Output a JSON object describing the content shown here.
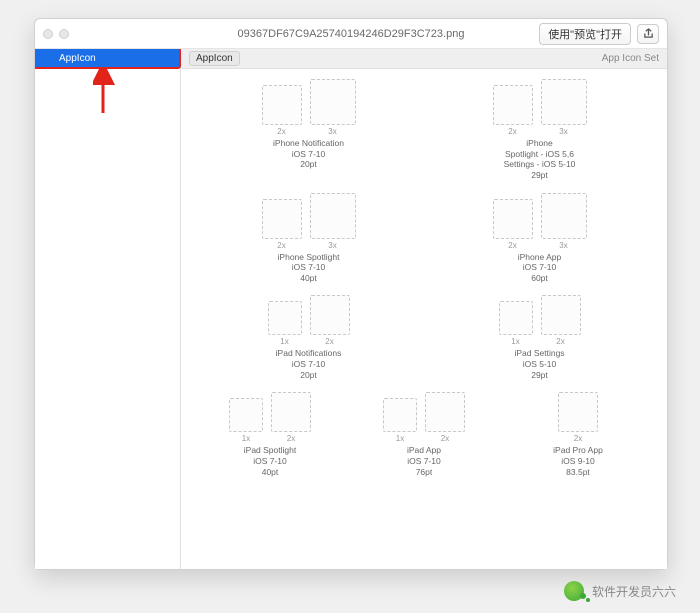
{
  "titlebar": {
    "filename": "09367DF67C9A25740194246D29F3C723.png",
    "open_label": "使用\"预览\"打开"
  },
  "sidebar": {
    "item_label": "AppIcon"
  },
  "main": {
    "header_title": "AppIcon",
    "header_subtitle": "App Icon Set",
    "rows": [
      {
        "groups": [
          {
            "scales": [
              "2x",
              "3x"
            ],
            "lines": [
              "iPhone Notification",
              "iOS 7-10",
              "20pt"
            ]
          },
          {
            "scales": [
              "2x",
              "3x"
            ],
            "lines": [
              "iPhone",
              "Spotlight - iOS 5,6",
              "Settings - iOS 5-10",
              "29pt"
            ]
          }
        ]
      },
      {
        "groups": [
          {
            "scales": [
              "2x",
              "3x"
            ],
            "lines": [
              "iPhone Spotlight",
              "iOS 7-10",
              "40pt"
            ]
          },
          {
            "scales": [
              "2x",
              "3x"
            ],
            "lines": [
              "iPhone App",
              "iOS 7-10",
              "60pt"
            ]
          }
        ]
      },
      {
        "groups": [
          {
            "scales": [
              "1x",
              "2x"
            ],
            "lines": [
              "iPad Notifications",
              "iOS 7-10",
              "20pt"
            ]
          },
          {
            "scales": [
              "1x",
              "2x"
            ],
            "lines": [
              "iPad Settings",
              "iOS 5-10",
              "29pt"
            ]
          }
        ]
      },
      {
        "three": true,
        "groups": [
          {
            "scales": [
              "1x",
              "2x"
            ],
            "lines": [
              "iPad Spotlight",
              "iOS 7-10",
              "40pt"
            ]
          },
          {
            "scales": [
              "1x",
              "2x"
            ],
            "lines": [
              "iPad App",
              "iOS 7-10",
              "76pt"
            ]
          },
          {
            "scales": [
              "2x"
            ],
            "lines": [
              "iPad Pro App",
              "iOS 9-10",
              "83.5pt"
            ]
          }
        ]
      }
    ]
  },
  "watermark": "软件开发员六六"
}
